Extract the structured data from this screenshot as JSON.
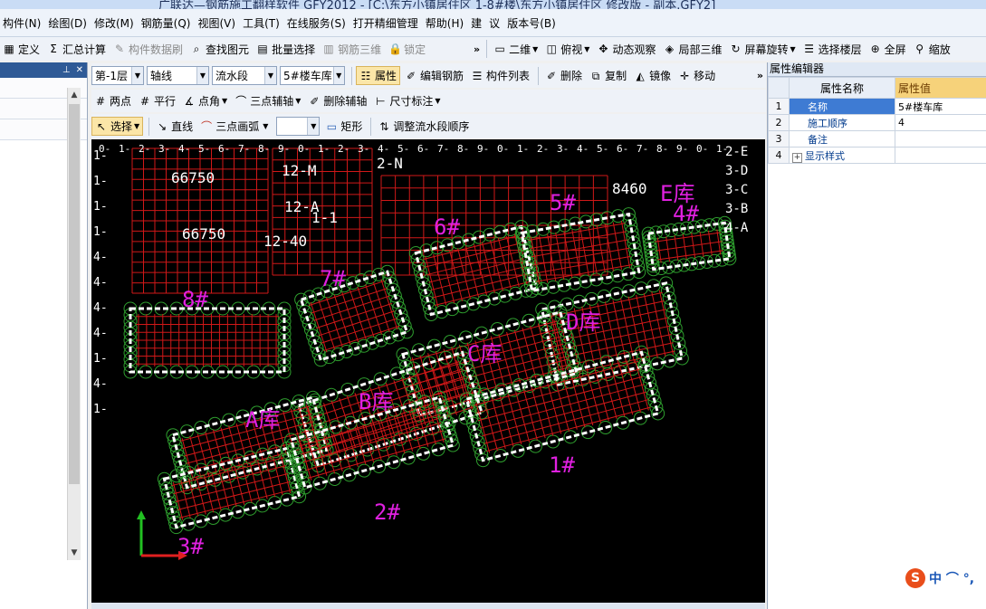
{
  "title": "广联达—钢筋施工翻样软件 GFY2012 - [C:\\东方小镇居住区 1-8#楼\\东方小镇居住区 修改版 - 副本.GFY2]",
  "menu": [
    "构件(N)",
    "绘图(D)",
    "修改(M)",
    "钢筋量(Q)",
    "视图(V)",
    "工具(T)",
    "在线服务(S)",
    "打开精细管理",
    "帮助(H)",
    "建",
    "议",
    "版本号(B)"
  ],
  "toolbar1": {
    "left": [
      {
        "label": "定义",
        "icon": "define-icon",
        "glyph": "▦",
        "enabled": true
      },
      {
        "label": "汇总计算",
        "icon": "sigma-icon",
        "glyph": "Σ",
        "enabled": true
      },
      {
        "label": "构件数据刷",
        "icon": "brush-icon",
        "glyph": "✎",
        "enabled": false
      },
      {
        "label": "查找图元",
        "icon": "find-icon",
        "glyph": "⌕",
        "enabled": true
      },
      {
        "label": "批量选择",
        "icon": "batch-select-icon",
        "glyph": "▤",
        "enabled": true
      },
      {
        "label": "钢筋三维",
        "icon": "rebar-3d-icon",
        "glyph": "▥",
        "enabled": false
      },
      {
        "label": "锁定",
        "icon": "lock-icon",
        "glyph": "🔒",
        "enabled": false
      }
    ],
    "right": [
      {
        "label": "二维",
        "icon": "2d-icon",
        "glyph": "▭",
        "dropdown": true
      },
      {
        "label": "俯视",
        "icon": "top-view-icon",
        "glyph": "◫",
        "dropdown": true
      },
      {
        "label": "动态观察",
        "icon": "orbit-icon",
        "glyph": "✥",
        "dropdown": false
      },
      {
        "label": "局部三维",
        "icon": "partial-3d-icon",
        "glyph": "◈",
        "dropdown": false
      },
      {
        "label": "屏幕旋转",
        "icon": "rotate-screen-icon",
        "glyph": "↻",
        "dropdown": true
      },
      {
        "label": "选择楼层",
        "icon": "select-floor-icon",
        "glyph": "☰",
        "dropdown": false
      },
      {
        "label": "全屏",
        "icon": "fullscreen-icon",
        "glyph": "⊕",
        "dropdown": false
      },
      {
        "label": "缩放",
        "icon": "zoom-icon",
        "glyph": "⚲",
        "dropdown": false
      }
    ]
  },
  "toolbar2": {
    "floor": "第-1层",
    "type": "轴线",
    "sub": "流水段",
    "element": "5#楼车库",
    "buttons": [
      {
        "label": "属性",
        "icon": "properties-icon",
        "glyph": "☷",
        "active": true
      },
      {
        "label": "编辑钢筋",
        "icon": "edit-rebar-icon",
        "glyph": "✐",
        "active": false
      },
      {
        "label": "构件列表",
        "icon": "component-list-icon",
        "glyph": "☰",
        "active": false
      }
    ],
    "edit": [
      {
        "label": "删除",
        "icon": "delete-icon",
        "glyph": "✐"
      },
      {
        "label": "复制",
        "icon": "copy-icon",
        "glyph": "⧉"
      },
      {
        "label": "镜像",
        "icon": "mirror-icon",
        "glyph": "◭"
      },
      {
        "label": "移动",
        "icon": "move-icon",
        "glyph": "✛"
      }
    ]
  },
  "toolbar3": [
    {
      "label": "两点",
      "icon": "two-point-icon",
      "glyph": "#",
      "dropdown": false
    },
    {
      "label": "平行",
      "icon": "parallel-icon",
      "glyph": "#",
      "dropdown": false
    },
    {
      "label": "点角",
      "icon": "point-angle-icon",
      "glyph": "∡",
      "dropdown": true
    },
    {
      "label": "三点辅轴",
      "icon": "three-point-axis-icon",
      "glyph": "⌒",
      "dropdown": true
    },
    {
      "label": "删除辅轴",
      "icon": "delete-axis-icon",
      "glyph": "✐",
      "dropdown": false
    },
    {
      "label": "尺寸标注",
      "icon": "dimension-icon",
      "glyph": "⊢",
      "dropdown": true
    }
  ],
  "toolbar4": {
    "select": "选择",
    "line": "直线",
    "arc": "三点画弧",
    "rect": "矩形",
    "adjust": "调整流水段顺序"
  },
  "canvas": {
    "labels": [
      {
        "text": "8#",
        "color": "magenta"
      },
      {
        "text": "7#",
        "color": "magenta"
      },
      {
        "text": "6#",
        "color": "magenta"
      },
      {
        "text": "5#",
        "color": "magenta"
      },
      {
        "text": "E库",
        "color": "magenta"
      },
      {
        "text": "4#",
        "color": "magenta"
      },
      {
        "text": "D库",
        "color": "magenta"
      },
      {
        "text": "C库",
        "color": "magenta"
      },
      {
        "text": "B库",
        "color": "magenta"
      },
      {
        "text": "A库",
        "color": "magenta"
      },
      {
        "text": "1#",
        "color": "magenta"
      },
      {
        "text": "2#",
        "color": "magenta"
      },
      {
        "text": "3#",
        "color": "magenta"
      }
    ],
    "dims": [
      "66750",
      "66750",
      "12-M",
      "12-40",
      "2-N",
      "8460",
      "12-A",
      "1-1"
    ],
    "axis_left": [
      "1-",
      "1-",
      "1-",
      "1-",
      "4-",
      "4-",
      "4-",
      "4-",
      "1-",
      "4-",
      "1-"
    ],
    "axis_right": [
      "2-E",
      "3-D",
      "3-C",
      "3-B",
      "4-A"
    ]
  },
  "property_editor": {
    "title": "属性编辑器",
    "col_name": "属性名称",
    "col_value": "属性值",
    "rows": [
      {
        "num": "1",
        "name": "名称",
        "value": "5#楼车库",
        "selected": true
      },
      {
        "num": "2",
        "name": "施工顺序",
        "value": "4",
        "selected": false
      },
      {
        "num": "3",
        "name": "备注",
        "value": "",
        "selected": false
      },
      {
        "num": "4",
        "name": "显示样式",
        "value": "",
        "selected": false,
        "expandable": true
      }
    ]
  },
  "ime": {
    "logo": "S",
    "text": "中 ⌒ °,"
  },
  "colors": {
    "canvas_bg": "#000000",
    "grid_red": "#d01818",
    "circle_green": "#2e9e2e",
    "label_magenta": "#e020e0",
    "text_white": "#ffffff",
    "selected_row": "#3e7bd3"
  }
}
